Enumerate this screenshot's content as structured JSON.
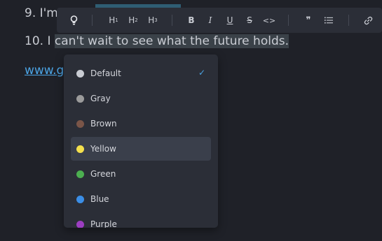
{
  "editor": {
    "line9_prefix": "9. I'm",
    "line10_prefix": "10. I ",
    "line10_selected": "can't wait to see what the future holds.",
    "link_text": "www.g"
  },
  "toolbar": {
    "lightbulb": "💡",
    "h1_main": "H",
    "h1_sub": "1",
    "h2_main": "H",
    "h2_sub": "2",
    "h3_main": "H",
    "h3_sub": "3",
    "bold": "B",
    "italic": "I",
    "underline": "U",
    "strike": "S",
    "code": "<>",
    "quote": "❞",
    "list": "☰",
    "link": "🔗"
  },
  "colors_menu": {
    "items": [
      {
        "label": "Default",
        "color": "#c9ccd3",
        "checked": true
      },
      {
        "label": "Gray",
        "color": "#9b9b9b"
      },
      {
        "label": "Brown",
        "color": "#7a5548"
      },
      {
        "label": "Yellow",
        "color": "#f4e04d",
        "active": true
      },
      {
        "label": "Green",
        "color": "#4caf50"
      },
      {
        "label": "Blue",
        "color": "#3b8ee6"
      },
      {
        "label": "Purple",
        "color": "#9c3ec1"
      }
    ],
    "check_mark": "✓"
  }
}
